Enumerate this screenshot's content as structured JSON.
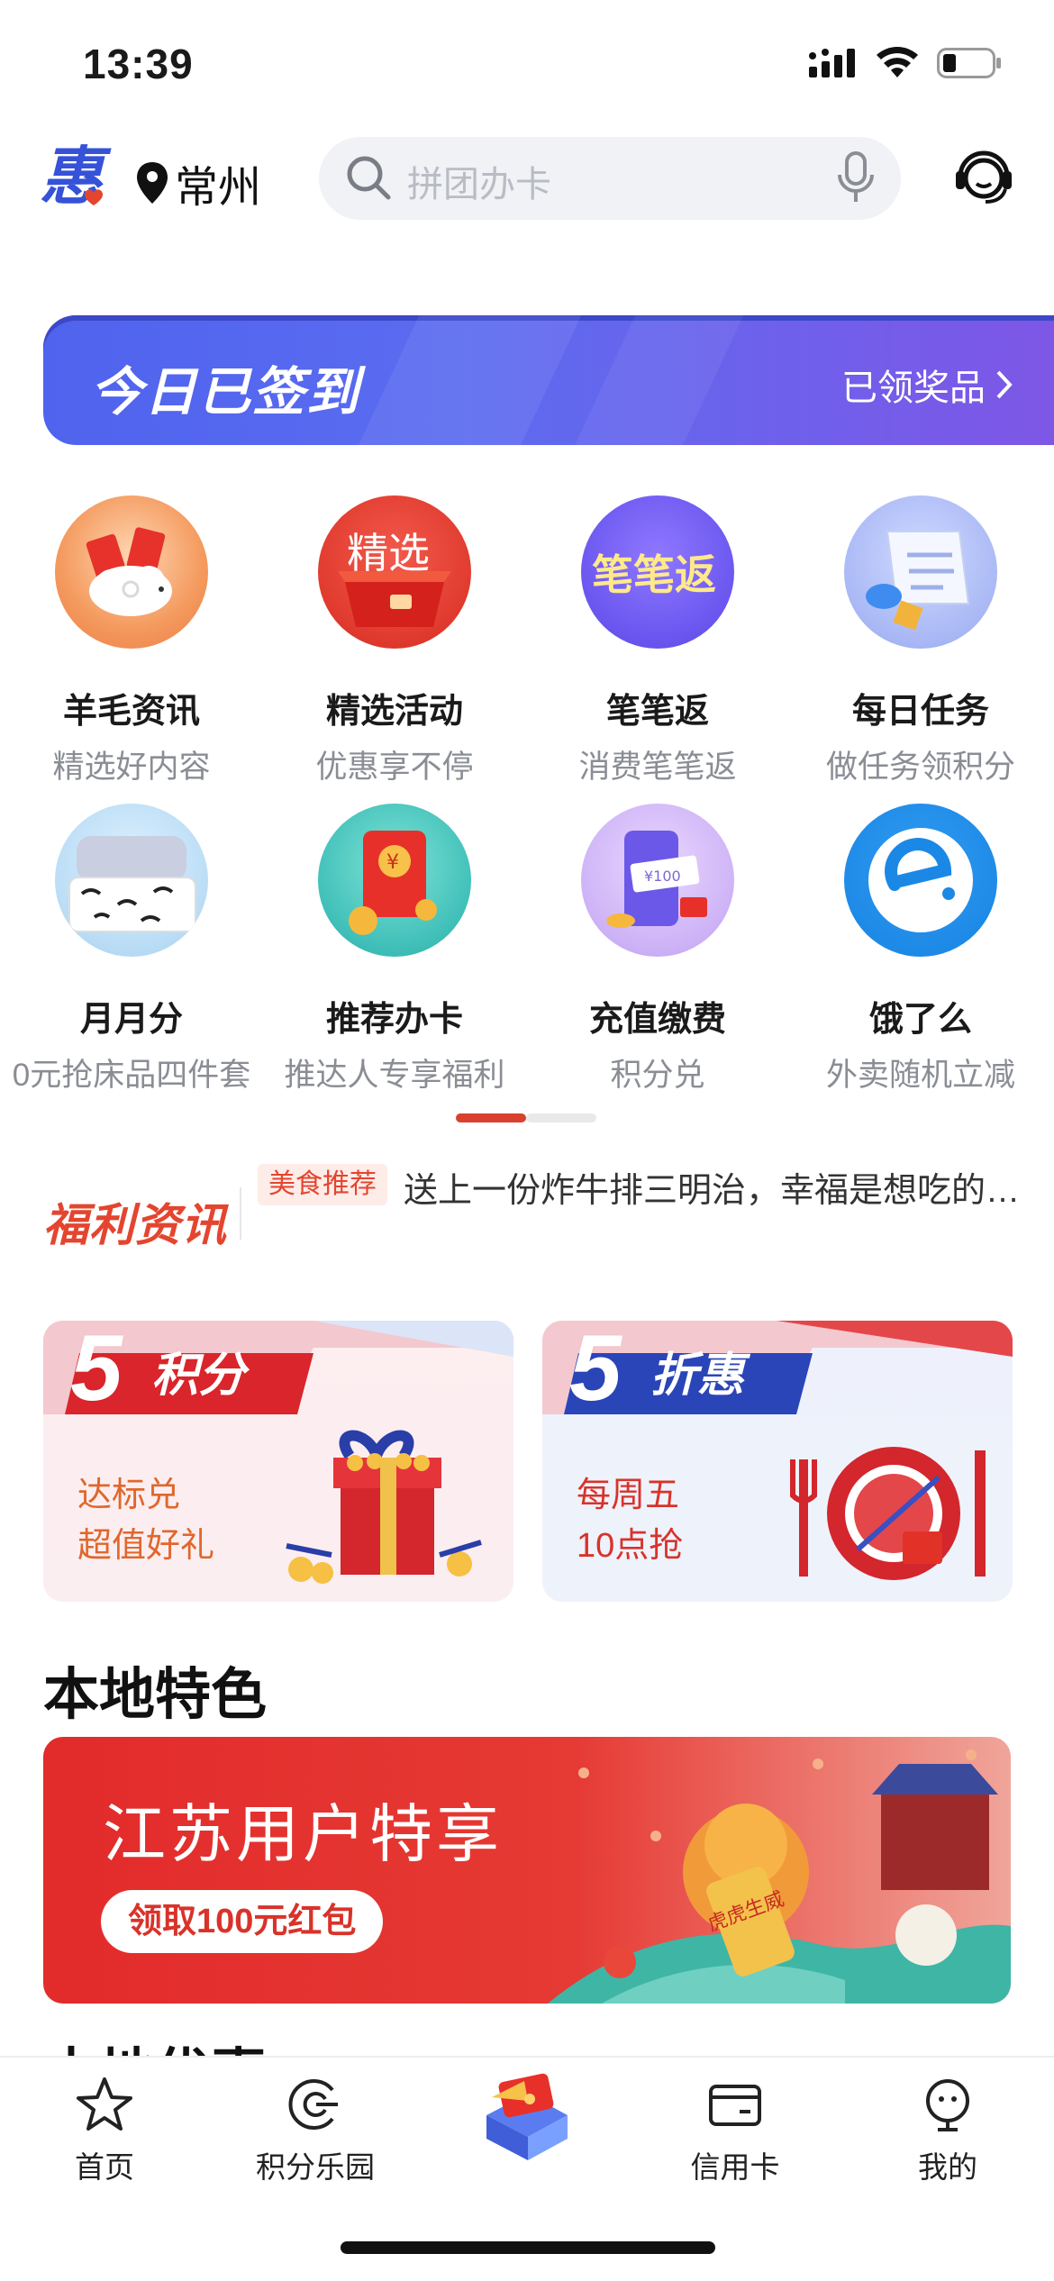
{
  "status_bar": {
    "time": "13:39"
  },
  "header": {
    "logo_char": "惠",
    "city": "常州",
    "search_placeholder": "拼团办卡"
  },
  "signin": {
    "title": "今日已签到",
    "link": "已领奖品"
  },
  "grid": [
    {
      "title": "羊毛资讯",
      "sub": "精选好内容",
      "icon": "red-envelope-sheep-icon"
    },
    {
      "title": "精选活动",
      "sub": "优惠享不停",
      "icon": "featured-gift-icon",
      "icon_text": "精选"
    },
    {
      "title": "笔笔返",
      "sub": "消费笔笔返",
      "icon": "cashback-icon",
      "icon_text": "笔笔返"
    },
    {
      "title": "每日任务",
      "sub": "做任务领积分",
      "icon": "task-scroll-icon"
    },
    {
      "title": "月月分",
      "sub": "0元抢床品四件套",
      "icon": "bedding-icon"
    },
    {
      "title": "推荐办卡",
      "sub": "推达人专享福利",
      "icon": "recommend-card-icon"
    },
    {
      "title": "充值缴费",
      "sub": "积分兑",
      "icon": "recharge-phone-icon"
    },
    {
      "title": "饿了么",
      "sub": "外卖随机立减",
      "icon": "eleme-icon"
    }
  ],
  "news": {
    "brand": "福利资讯",
    "tag": "美食推荐",
    "text": "送上一份炸牛排三明治，幸福是想吃的…"
  },
  "promos": [
    {
      "big": "5",
      "tag": "积分",
      "line1": "达标兑",
      "line2": "超值好礼"
    },
    {
      "big": "5",
      "tag": "折惠",
      "line1": "每周五",
      "line2": "10点抢"
    }
  ],
  "local": {
    "section_title": "本地特色",
    "banner_title": "江苏用户特享",
    "banner_button": "领取100元红包",
    "banner_scroll_text": "虎虎生威"
  },
  "next_section_title": "本地优惠",
  "tabbar": [
    {
      "label": "首页",
      "icon": "star-icon"
    },
    {
      "label": "积分乐园",
      "icon": "points-icon"
    },
    {
      "label": "",
      "icon": "center-wallet-icon"
    },
    {
      "label": "信用卡",
      "icon": "credit-card-icon"
    },
    {
      "label": "我的",
      "icon": "profile-icon"
    }
  ],
  "colors": {
    "accent_red": "#e4452f",
    "signin_blue": "#5b6cf0",
    "pager_active": "#d9402e"
  }
}
